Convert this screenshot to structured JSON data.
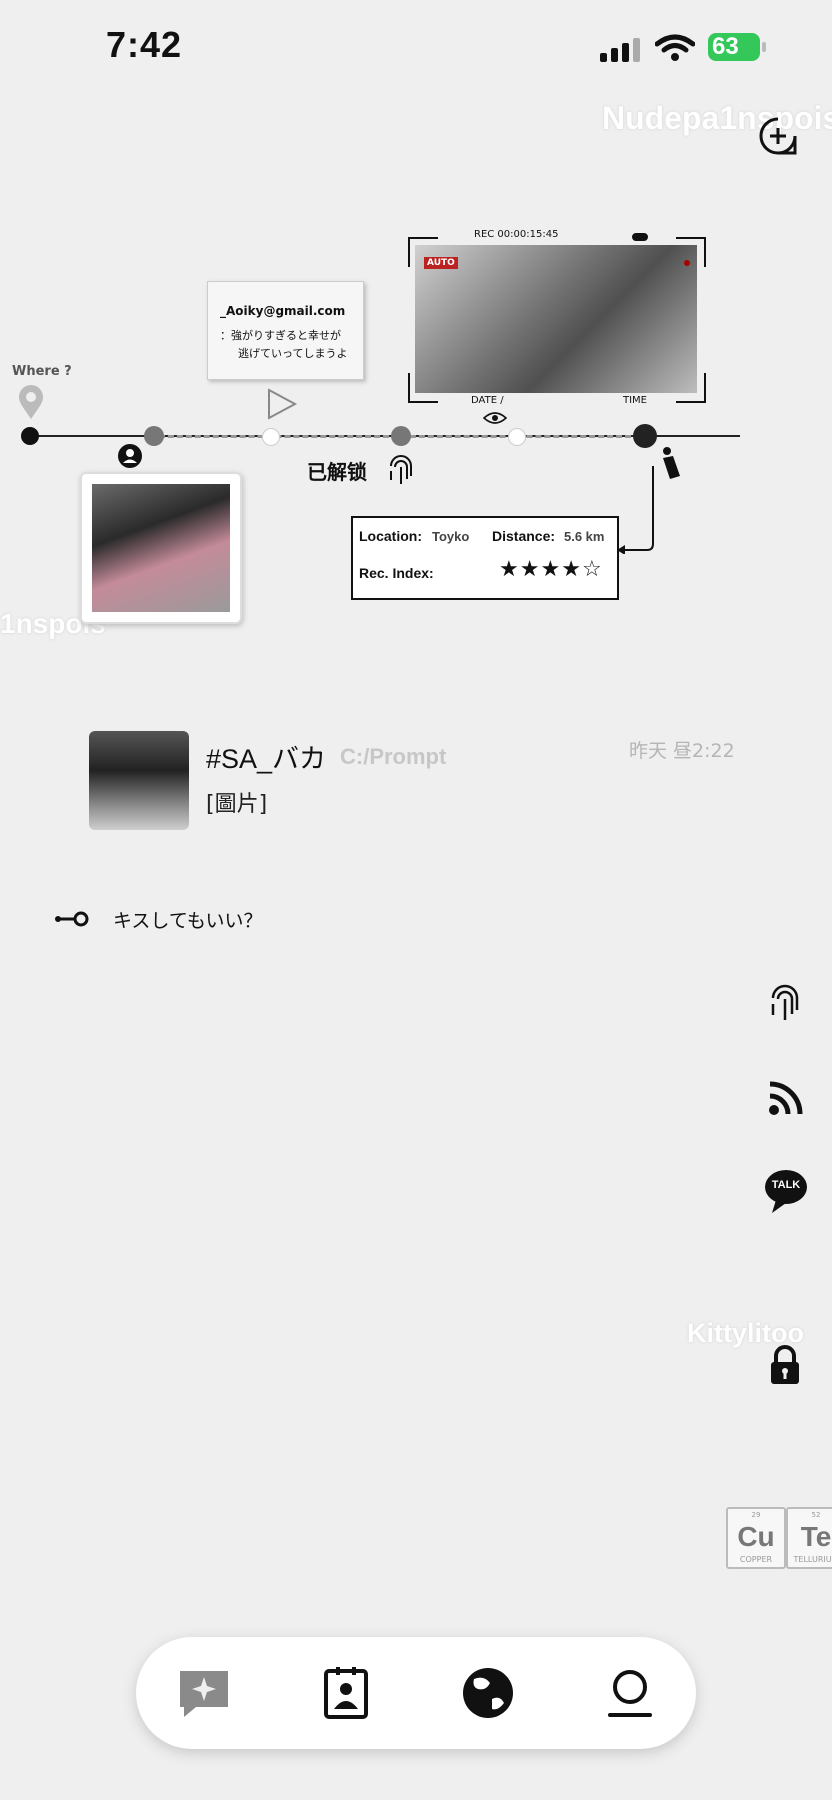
{
  "status_bar": {
    "time": "7:42",
    "battery": "63",
    "battery_color": "#34c759"
  },
  "watermarks": {
    "top_right": "Nudepa1nspois",
    "left": "1nspois",
    "right": "Kittylitoo"
  },
  "timeline": {
    "where_label": "Where ?",
    "email_card": {
      "email": "_Aoiky@gmail.com",
      "line1": "：強がりすぎると幸せが",
      "line2": "逃げていってしまうよ"
    },
    "camera": {
      "rec_label": "REC   00:00:15:45",
      "auto_badge": "AUTO",
      "date_label": "DATE /",
      "time_label": "TIME"
    },
    "unlock_label": "已解锁",
    "info": {
      "location_label": "Location:",
      "location_value": "Toyko",
      "distance_label": "Distance:",
      "distance_value": "5.6 km",
      "rec_index_label": "Rec. Index:",
      "rating": 4,
      "rating_max": 5
    }
  },
  "chat": {
    "name": "#SA_バカ",
    "path": "C:/Prompt",
    "message": "[圖片]",
    "time": "昨天 昼2:22"
  },
  "quote": {
    "text": "キスしてもいい？"
  },
  "side_icons": [
    "fingerprint-icon",
    "rss-icon",
    "talk-bubble-icon",
    "lock-icon"
  ],
  "talk_label": "TALK",
  "elements": [
    {
      "number": "29",
      "symbol": "Cu",
      "name": "COPPER"
    },
    {
      "number": "52",
      "symbol": "Te",
      "name": "TELLURIUM"
    }
  ],
  "tabbar": [
    "chats-tab",
    "contacts-tab",
    "discover-tab",
    "profile-tab"
  ]
}
